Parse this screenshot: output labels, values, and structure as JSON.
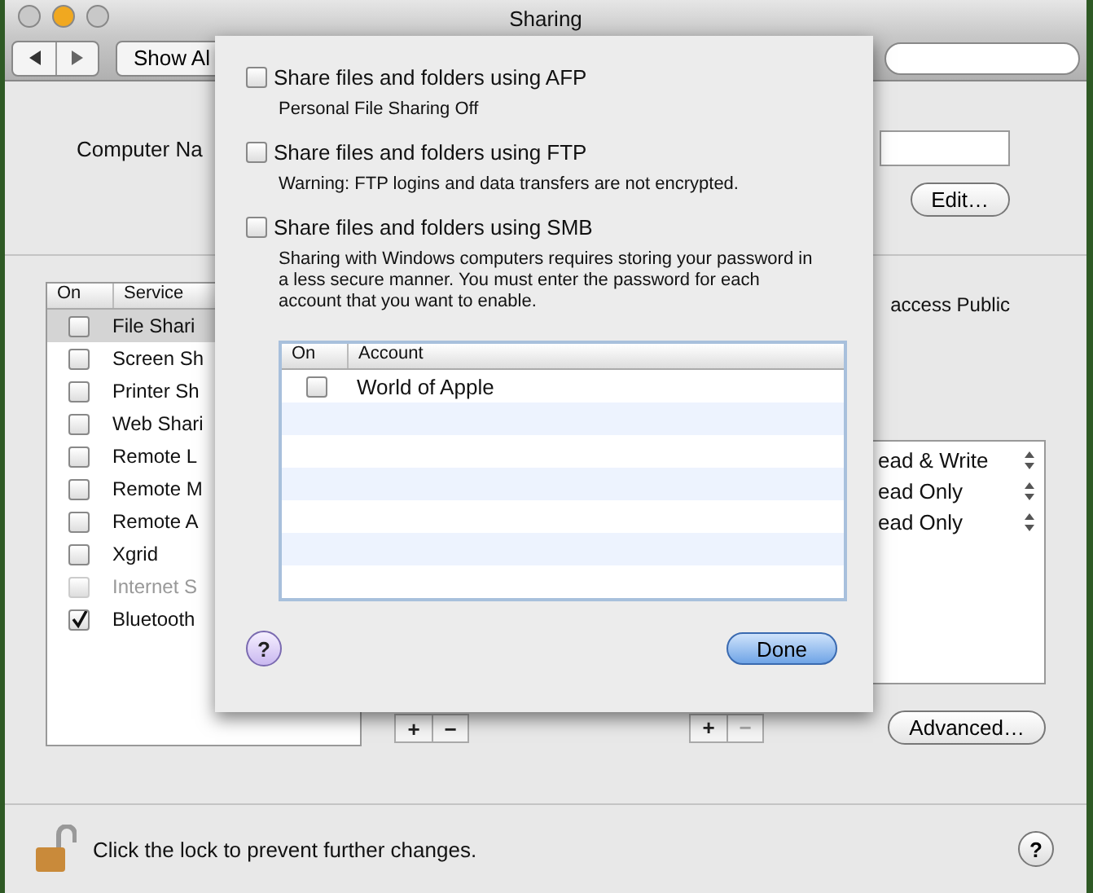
{
  "window": {
    "title": "Sharing"
  },
  "toolbar": {
    "show_all": "Show Al"
  },
  "computer_name": {
    "label": "Computer Na",
    "edit_button": "Edit…"
  },
  "services": {
    "columns": [
      "On",
      "Service"
    ],
    "rows": [
      {
        "name": "File Shari",
        "checked": false,
        "disabled": false,
        "selected": true
      },
      {
        "name": "Screen Sh",
        "checked": false,
        "disabled": false,
        "selected": false
      },
      {
        "name": "Printer Sh",
        "checked": false,
        "disabled": false,
        "selected": false
      },
      {
        "name": "Web Shari",
        "checked": false,
        "disabled": false,
        "selected": false
      },
      {
        "name": "Remote L",
        "checked": false,
        "disabled": false,
        "selected": false
      },
      {
        "name": "Remote M",
        "checked": false,
        "disabled": false,
        "selected": false
      },
      {
        "name": "Remote A",
        "checked": false,
        "disabled": false,
        "selected": false
      },
      {
        "name": "Xgrid",
        "checked": false,
        "disabled": false,
        "selected": false
      },
      {
        "name": "Internet S",
        "checked": false,
        "disabled": true,
        "selected": false
      },
      {
        "name": "Bluetooth",
        "checked": true,
        "disabled": false,
        "selected": false
      }
    ]
  },
  "access_note": "access Public",
  "permissions": [
    "ead & Write",
    "ead Only",
    "ead Only"
  ],
  "list_buttons": [
    {
      "plus": "+",
      "minus": "−",
      "minus_disabled": false
    },
    {
      "plus": "+",
      "minus": "−",
      "minus_disabled": true
    }
  ],
  "advanced_button": "Advanced…",
  "lock": {
    "text": "Click the lock to prevent further changes.",
    "locked": false
  },
  "help": "?",
  "sheet": {
    "options": [
      {
        "label": "Share files and folders using AFP",
        "checked": false,
        "note": "Personal File Sharing Off"
      },
      {
        "label": "Share files and folders using FTP",
        "checked": false,
        "note": "Warning: FTP logins and data transfers are not encrypted."
      },
      {
        "label": "Share files and folders using SMB",
        "checked": false,
        "note": "Sharing with Windows computers requires storing your password in a less secure manner.  You must enter the password for each account that you want to enable."
      }
    ],
    "columns": [
      "On",
      "Account"
    ],
    "accounts": [
      {
        "name": "World of Apple",
        "checked": false
      }
    ],
    "help": "?",
    "done": "Done"
  }
}
